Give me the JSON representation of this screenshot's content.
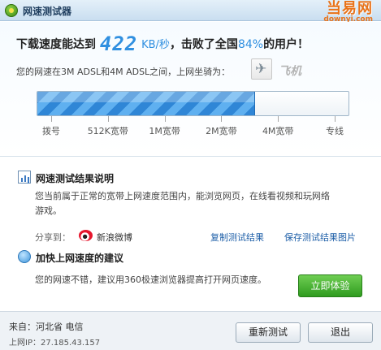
{
  "titlebar": {
    "title": "网速测试器",
    "brand_main": "当易网",
    "brand_sub": "downyi.com"
  },
  "result": {
    "headline_prefix": "下载速度能达到",
    "speed_value": "422",
    "speed_unit": "KB/秒",
    "headline_middle": "，击败了全国",
    "percentile": "84%",
    "headline_suffix": "的用户！",
    "ride_text": "您的网速在3M ADSL和4M ADSL之间，上网坐骑为：",
    "ride_name": "飞机",
    "ride_icon": "airplane-icon"
  },
  "progress": {
    "fraction": 0.7,
    "ticks": [
      "拨号",
      "512K宽带",
      "1M宽带",
      "2M宽带",
      "4M宽带",
      "专线"
    ],
    "fill_color": "#2f86d6"
  },
  "explain": {
    "title": "网速测试结果说明",
    "text_line1": "您当前属于正常的宽带上网速度范围内，能浏览网页，在线看视频和玩网络",
    "text_line2": "游戏。",
    "share_label": "分享到：",
    "weibo_label": "新浪微博",
    "copy_link": "复制测试结果",
    "save_link": "保存测试结果图片"
  },
  "advice": {
    "title": "加快上网速度的建议",
    "text": "您的网速不错，建议用360极速浏览器提高打开网页速度。",
    "try_button": "立即体验"
  },
  "footer": {
    "location": "来自：河北省 电信",
    "ip": "上网IP：27.185.43.157",
    "retest_button": "重新测试",
    "exit_button": "退出"
  }
}
